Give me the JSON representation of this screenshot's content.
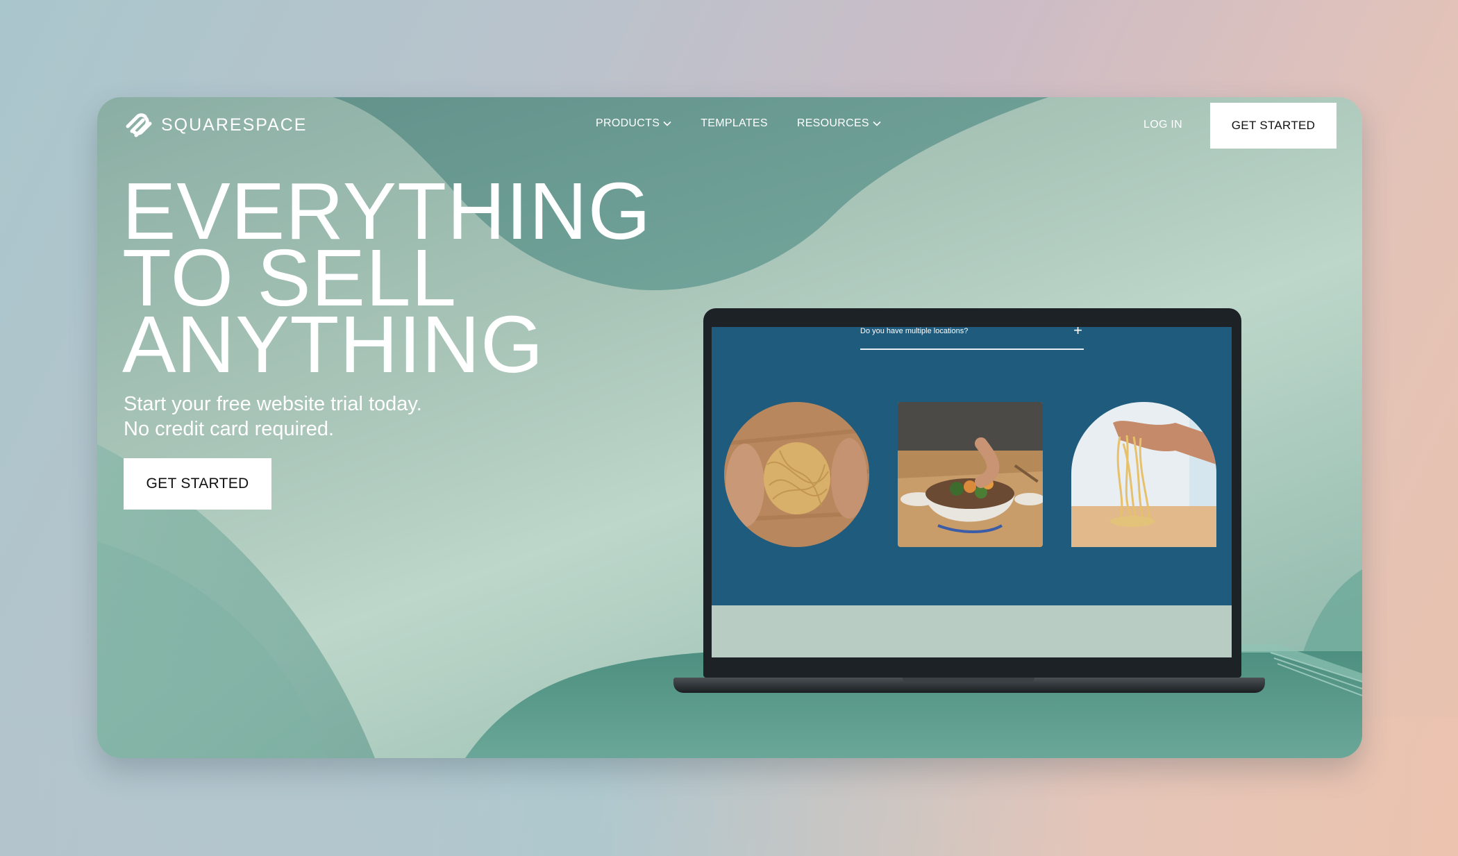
{
  "brand": {
    "name": "SQUARESPACE",
    "logo_icon": "squarespace-logo-icon"
  },
  "nav": {
    "items": [
      {
        "label": "PRODUCTS",
        "has_dropdown": true
      },
      {
        "label": "TEMPLATES",
        "has_dropdown": false
      },
      {
        "label": "RESOURCES",
        "has_dropdown": true
      }
    ],
    "login_label": "LOG IN",
    "cta_label": "GET STARTED"
  },
  "hero": {
    "headline_lines": [
      "EVERYTHING",
      "TO SELL",
      "ANYTHING"
    ],
    "subtext_lines": [
      "Start your free website trial today.",
      "No credit card required."
    ],
    "cta_label": "GET STARTED"
  },
  "laptop_screen": {
    "faq_question": "Do you have multiple locations?",
    "faq_toggle_icon": "plus-icon",
    "photos": [
      "noodle-nest-photo",
      "ramen-bowl-photo",
      "noodle-pull-photo"
    ],
    "background_color": "#1f5b7c",
    "footer_color": "#b8ccc3"
  },
  "colors": {
    "accent_teal": "#5f9c90",
    "cta_background": "#ffffff",
    "cta_text": "#111111"
  }
}
